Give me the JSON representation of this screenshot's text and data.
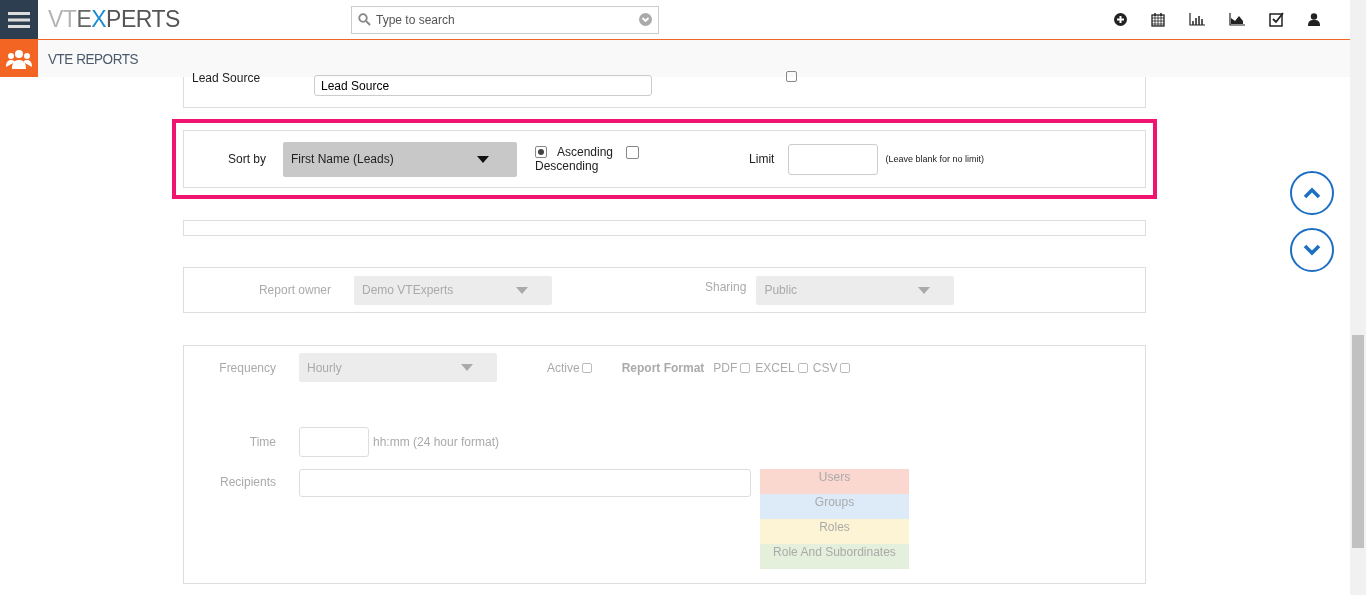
{
  "header": {
    "logo": [
      {
        "text": "VT",
        "color": "#b4b4b4"
      },
      {
        "text": "E",
        "color": "#666666"
      },
      {
        "text": "X",
        "color": "#1a8ccf"
      },
      {
        "text": "PERTS",
        "color": "#555555"
      }
    ],
    "search": {
      "placeholder": "Type to search"
    }
  },
  "subheader": {
    "title": "VTE REPORTS"
  },
  "filter": {
    "label": "Lead Source",
    "value": "Lead Source",
    "checked": false
  },
  "sort": {
    "highlighted": true,
    "label": "Sort by",
    "field": "First Name (Leads)",
    "ascending_label": "Ascending",
    "ascending_selected": true,
    "descending_label": "Descending",
    "descending_selected": false,
    "limit_label": "Limit",
    "limit_hint": "(Leave blank for no limit)"
  },
  "owner": {
    "label": "Report owner",
    "value": "Demo VTExperts",
    "sharing_label": "Sharing",
    "sharing_value": "Public"
  },
  "schedule": {
    "frequency_label": "Frequency",
    "frequency": "Hourly",
    "active_label": "Active",
    "active": false,
    "format_label": "Report Format",
    "formats": [
      {
        "label": "PDF",
        "checked": false
      },
      {
        "label": "EXCEL",
        "checked": false
      },
      {
        "label": "CSV",
        "checked": false
      }
    ],
    "time_label": "Time",
    "time_hint": "hh:mm (24 hour format)",
    "recipients_label": "Recipients",
    "recipient_types": [
      {
        "label": "Users",
        "color": "#fad7cf"
      },
      {
        "label": "Groups",
        "color": "#ddebf9"
      },
      {
        "label": "Roles",
        "color": "#fdf4d6"
      },
      {
        "label": "Role And Subordinates",
        "color": "#e4f0dc"
      }
    ]
  }
}
